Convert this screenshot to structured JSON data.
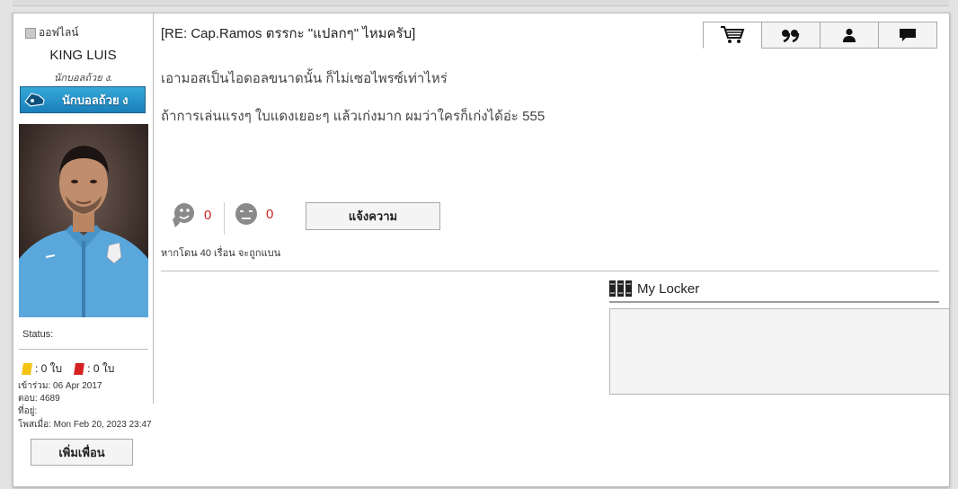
{
  "user": {
    "status": "ออฟไลน์",
    "name": "KING LUIS",
    "rank": "นักบอลถ้วย ง.",
    "badge": "นักบอลถ้วย ง",
    "status_label": "Status:",
    "yellow_cards": ": 0 ใบ",
    "red_cards": ": 0 ใบ",
    "joined": "เข้าร่วม: 06 Apr 2017",
    "replies": "ตอบ: 4689",
    "location": "ที่อยู่:",
    "posted": "โพสเมื่อ: Mon Feb 20, 2023 23:47",
    "add_friend": "เพิ่มเพื่อน"
  },
  "post": {
    "title": "[RE: Cap.Ramos ตรรกะ \"แปลกๆ\" ไหมครับ]",
    "lines": [
      "เอามอสเป็นไอดอลขนาดนั้น ก็ไม่เซอไพรซ์เท่าไหร่",
      "ถ้าการเล่นแรงๆ ใบแดงเยอะๆ แล้วเก่งมาก ผมว่าใครก็เก่งได้อ่ะ 555"
    ],
    "likes": "0",
    "dislikes": "0",
    "report": "แจ้งความ",
    "ban_note": "หากโดน 40 เรื่อน จะถูกแบน"
  },
  "actions": [
    "cart-icon",
    "quote-icon",
    "profile-icon",
    "message-icon"
  ],
  "locker": {
    "title": "My Locker"
  },
  "colors": {
    "badge": "#1a7fb9",
    "vote_count": "#cc2222",
    "yellow_card": "#f3c316",
    "red_card": "#d42222"
  }
}
